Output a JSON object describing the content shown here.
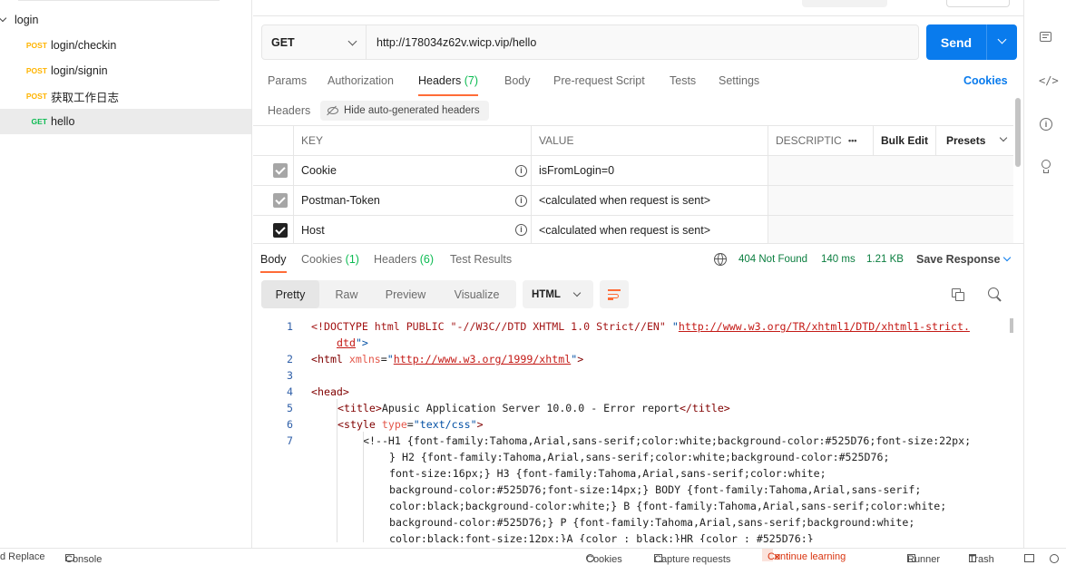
{
  "sidebar": {
    "folder": "login",
    "items": [
      {
        "method": "POST",
        "name": "login/checkin"
      },
      {
        "method": "POST",
        "name": "login/signin"
      },
      {
        "method": "POST",
        "name": "获取工作日志"
      },
      {
        "method": "GET",
        "name": "hello"
      }
    ]
  },
  "request": {
    "method": "GET",
    "url": "http://178034z62v.wicp.vip/hello",
    "send_label": "Send"
  },
  "request_tabs": {
    "params": "Params",
    "authorization": "Authorization",
    "headers": "Headers",
    "headers_count": "(7)",
    "body": "Body",
    "pre_request": "Pre-request Script",
    "tests": "Tests",
    "settings": "Settings",
    "cookies": "Cookies"
  },
  "headers_section": {
    "title": "Headers",
    "hide_auto": "Hide auto-generated headers",
    "columns": {
      "key": "KEY",
      "value": "VALUE",
      "description": "DESCRIPTIC",
      "more": "•••",
      "bulk_edit": "Bulk Edit",
      "presets": "Presets"
    },
    "rows": [
      {
        "key": "Cookie",
        "value": "isFromLogin=0",
        "checked_style": "grey"
      },
      {
        "key": "Postman-Token",
        "value": "<calculated when request is sent>",
        "checked_style": "grey"
      },
      {
        "key": "Host",
        "value": "<calculated when request is sent>",
        "checked_style": "black"
      }
    ]
  },
  "response": {
    "tabs": {
      "body": "Body",
      "cookies": "Cookies",
      "cookies_count": "(1)",
      "headers": "Headers",
      "headers_count": "(6)",
      "test_results": "Test Results"
    },
    "status": "404 Not Found",
    "time": "140 ms",
    "size": "1.21 KB",
    "save": "Save Response",
    "views": [
      "Pretty",
      "Raw",
      "Preview",
      "Visualize"
    ],
    "format": "HTML"
  },
  "code_lines": [
    {
      "n": "1",
      "segments": [
        "<!DOCTYPE html PUBLIC \"-//W3C//DTD XHTML 1.0 Strict//EN\" ",
        "\"",
        "http://www.w3.org/TR/xhtml1/DTD/xhtml1-strict.",
        "dtd",
        "\">"
      ]
    },
    {
      "n": "2",
      "segments": [
        "<html ",
        "xmlns",
        "=",
        "\"",
        "http://www.w3.org/1999/xhtml",
        "\"",
        ">"
      ]
    },
    {
      "n": "3",
      "segments": [
        ""
      ]
    },
    {
      "n": "4",
      "segments": [
        "<head>"
      ]
    },
    {
      "n": "5",
      "segments": [
        "<title>",
        "Apusic Application Server 10.0.0 - Error report",
        "</title>"
      ]
    },
    {
      "n": "6",
      "segments": [
        "<style ",
        "type",
        "=",
        "\"text/css\"",
        ">"
      ]
    },
    {
      "n": "7",
      "segments": [
        "<!--H1 {font-family:Tahoma,Arial,sans-serif;color:white;background-color:#525D76;font-size:22px;",
        "} H2 {font-family:Tahoma,Arial,sans-serif;color:white;background-color:#525D76;",
        "font-size:16px;} H3 {font-family:Tahoma,Arial,sans-serif;color:white;",
        "background-color:#525D76;font-size:14px;} BODY {font-family:Tahoma,Arial,sans-serif;",
        "color:black;background-color:white;} B {font-family:Tahoma,Arial,sans-serif;color:white;",
        "background-color:#525D76;} P {font-family:Tahoma,Arial,sans-serif;background:white;",
        "color:black;font-size:12px;}A {color : black;}HR {color : #525D76;}"
      ]
    }
  ],
  "status_bar": {
    "find_replace": "d Replace",
    "console": "Console",
    "cookies": "Cookies",
    "capture": "Capture requests",
    "continue_learning": "Continue learning",
    "runner": "Runner",
    "trash": "Trash"
  },
  "colors": {
    "accent": "#ff6c37",
    "send": "#097bed",
    "status_ok": "#0a7e3f",
    "count": "#0cbb52"
  }
}
